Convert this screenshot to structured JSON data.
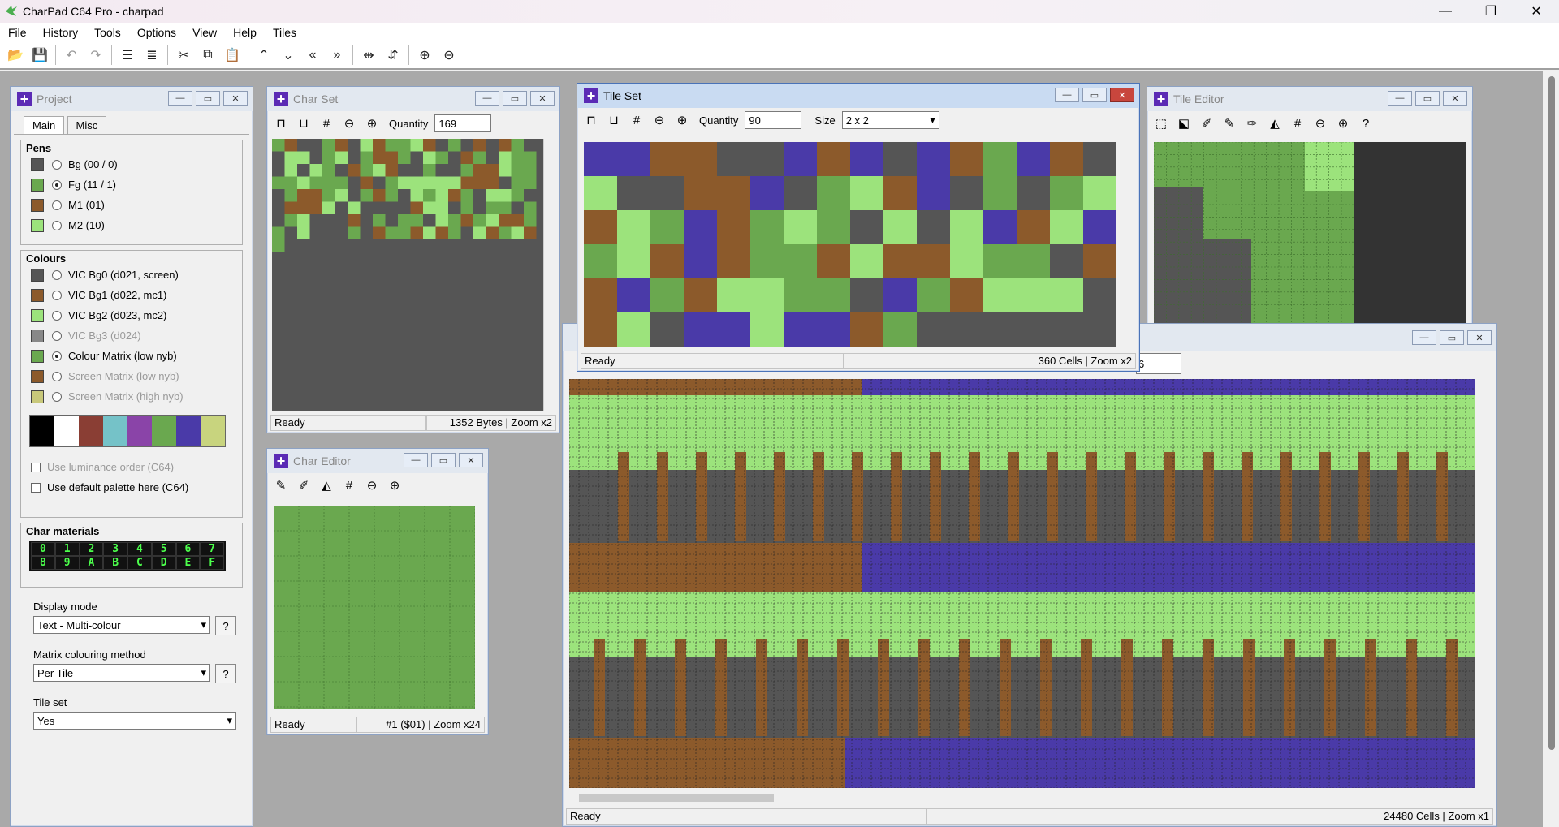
{
  "titlebar": {
    "title": "CharPad C64 Pro - charpad",
    "min": "—",
    "restore": "❐",
    "close": "✕"
  },
  "menu": [
    "File",
    "History",
    "Tools",
    "Options",
    "View",
    "Help",
    "Tiles"
  ],
  "project": {
    "title": "Project",
    "tabs": [
      "Main",
      "Misc"
    ],
    "pens": {
      "label": "Pens",
      "items": [
        {
          "label": "Bg (00 / 0)",
          "color": "#555555",
          "selected": false
        },
        {
          "label": "Fg (11 / 1)",
          "color": "#6aa84f",
          "selected": true
        },
        {
          "label": "M1 (01)",
          "color": "#8c5a2b",
          "selected": false
        },
        {
          "label": "M2 (10)",
          "color": "#9ce37c",
          "selected": false
        }
      ]
    },
    "colours": {
      "label": "Colours",
      "items": [
        {
          "label": "VIC Bg0 (d021, screen)",
          "color": "#555555",
          "enabled": true,
          "selected": false
        },
        {
          "label": "VIC Bg1 (d022, mc1)",
          "color": "#8c5a2b",
          "enabled": true,
          "selected": false
        },
        {
          "label": "VIC Bg2 (d023, mc2)",
          "color": "#9ce37c",
          "enabled": true,
          "selected": false
        },
        {
          "label": "VIC Bg3 (d024)",
          "color": "#888888",
          "enabled": false,
          "selected": false
        },
        {
          "label": "Colour Matrix (low nyb)",
          "color": "#6aa84f",
          "enabled": true,
          "selected": true
        },
        {
          "label": "Screen Matrix (low nyb)",
          "color": "#8c5a2b",
          "enabled": false,
          "selected": false
        },
        {
          "label": "Screen Matrix (high nyb)",
          "color": "#c8c87a",
          "enabled": false,
          "selected": false
        }
      ],
      "palette": [
        "#000000",
        "#ffffff",
        "#8a3e34",
        "#75c2c8",
        "#8a44a8",
        "#6aa84f",
        "#4a3aa8",
        "#c8d47e"
      ],
      "use_luminance": "Use luminance order (C64)",
      "use_default": "Use default palette here (C64)"
    },
    "materials": {
      "label": "Char materials",
      "row1": [
        "0",
        "1",
        "2",
        "3",
        "4",
        "5",
        "6",
        "7"
      ],
      "row2": [
        "8",
        "9",
        "A",
        "B",
        "C",
        "D",
        "E",
        "F"
      ]
    },
    "display_mode": {
      "label": "Display mode",
      "value": "Text - Multi-colour"
    },
    "matrix_method": {
      "label": "Matrix colouring method",
      "value": "Per Tile"
    },
    "tile_set": {
      "label": "Tile set",
      "value": "Yes"
    },
    "help": "?"
  },
  "charset": {
    "title": "Char Set",
    "qty_label": "Quantity",
    "qty": "169",
    "status": "Ready",
    "info": "1352 Bytes | Zoom x2"
  },
  "tileset": {
    "title": "Tile Set",
    "qty_label": "Quantity",
    "qty": "90",
    "size_label": "Size",
    "size": "2 x 2",
    "status": "Ready",
    "info": "360 Cells | Zoom x2"
  },
  "tileeditor": {
    "title": "Tile Editor",
    "help": "?"
  },
  "chareditor": {
    "title": "Char Editor",
    "status": "Ready",
    "info": "#1 ($01) | Zoom x24"
  },
  "mapeditor": {
    "field": "6",
    "status": "Ready",
    "info": "24480 Cells | Zoom x1"
  },
  "colors": {
    "bg": "#555555",
    "fg": "#6aa84f",
    "m1": "#8c5a2b",
    "m2": "#9ce37c",
    "blue": "#4a3aa8"
  }
}
